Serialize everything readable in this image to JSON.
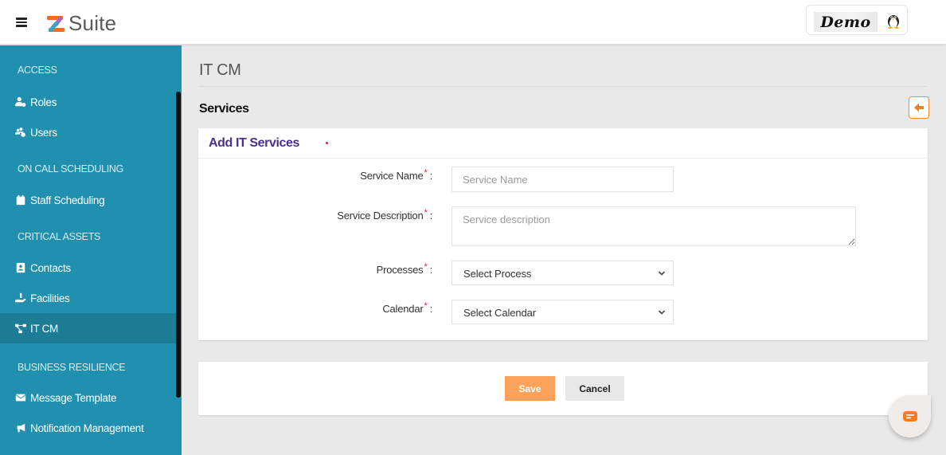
{
  "header": {
    "app_name": "Suite",
    "user_badge_text": "Demo"
  },
  "sidebar": {
    "sections": [
      {
        "title": "ACCESS"
      },
      {
        "title": "ON CALL SCHEDULING"
      },
      {
        "title": "CRITICAL ASSETS"
      },
      {
        "title": "BUSINESS RESILIENCE"
      }
    ],
    "items": [
      {
        "label": "Roles",
        "icon": "user-cog-icon"
      },
      {
        "label": "Users",
        "icon": "users-cog-icon"
      },
      {
        "label": "Staff Scheduling",
        "icon": "calendar-icon"
      },
      {
        "label": "Contacts",
        "icon": "address-book-icon"
      },
      {
        "label": "Facilities",
        "icon": "hand-holding-icon"
      },
      {
        "label": "IT CM",
        "icon": "network-icon",
        "active": true
      },
      {
        "label": "Message Template",
        "icon": "envelope-icon"
      },
      {
        "label": "Notification Management",
        "icon": "megaphone-icon"
      }
    ]
  },
  "main": {
    "page_title": "IT CM",
    "section_heading": "Services",
    "back_icon": "arrow-left-icon",
    "card_title": "Add IT Services",
    "form": {
      "service_name": {
        "label": "Service Name",
        "required_mark": "*",
        "colon": ":",
        "value": "",
        "placeholder": "Service Name"
      },
      "service_description": {
        "label": "Service Description",
        "required_mark": "*",
        "colon": ":",
        "value": "",
        "placeholder": "Service description"
      },
      "processes": {
        "label": "Processes",
        "required_mark": "*",
        "colon": ":",
        "selected": "Select Process"
      },
      "calendar": {
        "label": "Calendar",
        "required_mark": "*",
        "colon": ":",
        "selected": "Select Calendar"
      }
    },
    "actions": {
      "save_label": "Save",
      "cancel_label": "Cancel"
    }
  },
  "colors": {
    "sidebar_bg": "#2190ae",
    "sidebar_active": "#1d7d97",
    "accent_orange": "#f57c1f",
    "save_button": "#fda25b",
    "card_title": "#4b2f8f",
    "required": "#e0202a"
  }
}
